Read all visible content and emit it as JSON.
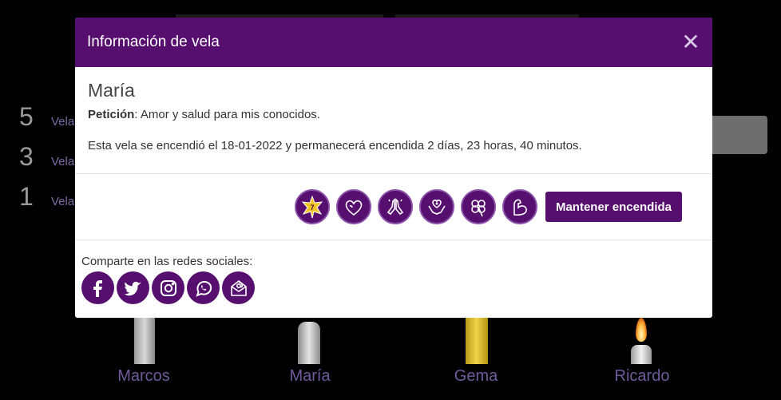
{
  "background": {
    "stats": [
      {
        "count": "5",
        "label": "Velas"
      },
      {
        "count": "3",
        "label": "Velas"
      },
      {
        "count": "1",
        "label": "Velas"
      }
    ],
    "candles": [
      {
        "name": "Marcos"
      },
      {
        "name": "María"
      },
      {
        "name": "Gema"
      },
      {
        "name": "Ricardo"
      }
    ]
  },
  "modal": {
    "title": "Información de vela",
    "close_symbol": "✕",
    "owner": "María",
    "petition_label": "Petición",
    "petition_text": ": Amor y salud para mis conocidos.",
    "info": "Esta vela se encendió el 18-01-2022 y permanecerá encendida 2 días, 23 horas, 40 minutos.",
    "actions": [
      {
        "icon": "star-seal-icon"
      },
      {
        "icon": "hearts-icon"
      },
      {
        "icon": "praying-hands-icon"
      },
      {
        "icon": "health-hands-icon"
      },
      {
        "icon": "clover-icon"
      },
      {
        "icon": "strength-arm-icon"
      }
    ],
    "keep_lit_label": "Mantener encendida",
    "share_label": "Comparte en las redes sociales:",
    "socials": [
      {
        "icon": "facebook-icon"
      },
      {
        "icon": "twitter-icon"
      },
      {
        "icon": "instagram-icon"
      },
      {
        "icon": "whatsapp-icon"
      },
      {
        "icon": "email-icon"
      }
    ]
  },
  "colors": {
    "accent": "#560f6e",
    "background": "#000000",
    "candle_name": "#6f5a9c"
  }
}
